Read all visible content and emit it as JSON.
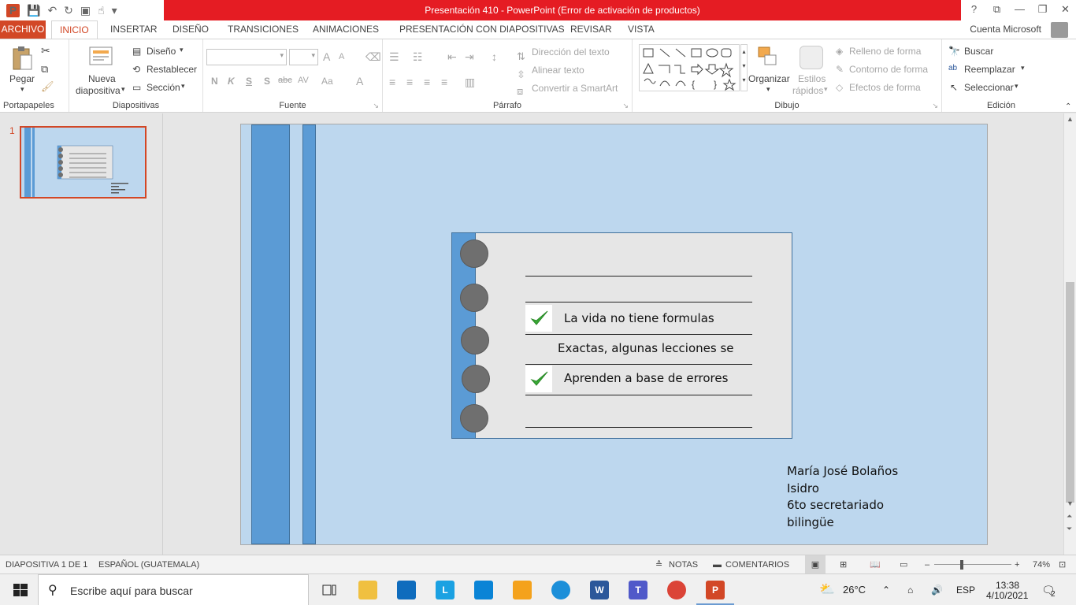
{
  "window": {
    "title": "Presentación 410 -  PowerPoint (Error de activación de productos)",
    "help": "?",
    "controls": [
      "?",
      "⧉",
      "—",
      "❐",
      "✕"
    ]
  },
  "tabs": [
    "ARCHIVO",
    "INICIO",
    "INSERTAR",
    "DISEÑO",
    "TRANSICIONES",
    "ANIMACIONES",
    "PRESENTACIÓN CON DIAPOSITIVAS",
    "REVISAR",
    "VISTA"
  ],
  "account": "Cuenta Microsoft",
  "ribbon": {
    "portapapeles": {
      "name": "Portapapeles",
      "paste": "Pegar"
    },
    "diapositivas": {
      "name": "Diapositivas",
      "new_line1": "Nueva",
      "new_line2": "diapositiva",
      "layout": "Diseño",
      "reset": "Restablecer",
      "section": "Sección"
    },
    "fuente": {
      "name": "Fuente",
      "bold": "N",
      "italic": "K",
      "underline": "S",
      "shadow": "S",
      "strike": "abc",
      "spacing": "AV",
      "case": "Aa",
      "grow": "A",
      "shrink": "A",
      "color": "A"
    },
    "parrafo": {
      "name": "Párrafo",
      "text_dir": "Dirección del texto",
      "align_text": "Alinear texto",
      "smartart": "Convertir a SmartArt"
    },
    "dibujo": {
      "name": "Dibujo",
      "arrange": "Organizar",
      "styles_line1": "Estilos",
      "styles_line2": "rápidos",
      "fill": "Relleno de forma",
      "outline": "Contorno de forma",
      "effects": "Efectos de forma"
    },
    "edicion": {
      "name": "Edición",
      "find": "Buscar",
      "replace": "Reemplazar",
      "select": "Seleccionar"
    }
  },
  "slide_number": "1",
  "slide": {
    "lines": [
      "La vida no tiene formulas",
      "Exactas, algunas lecciones se",
      "Aprenden a base de errores"
    ],
    "author_lines": [
      "María José Bolaños",
      "Isidro",
      "6to secretariado",
      "bilingüe"
    ]
  },
  "status": {
    "slide": "DIAPOSITIVA 1 DE 1",
    "language": "ESPAÑOL (GUATEMALA)",
    "notes": "NOTAS",
    "comments": "COMENTARIOS",
    "zoom": "74%"
  },
  "taskbar": {
    "search_placeholder": "Escribe aquí para buscar",
    "temperature": "26°C",
    "lang": "ESP",
    "time": "13:38",
    "date": "4/10/2021",
    "notifications": "2"
  },
  "colors": {
    "accent": "#d24726",
    "titlebar_red": "#e51c23",
    "slide_bg": "#bdd7ee",
    "blue": "#5b9bd5",
    "check_green": "#39a935"
  }
}
